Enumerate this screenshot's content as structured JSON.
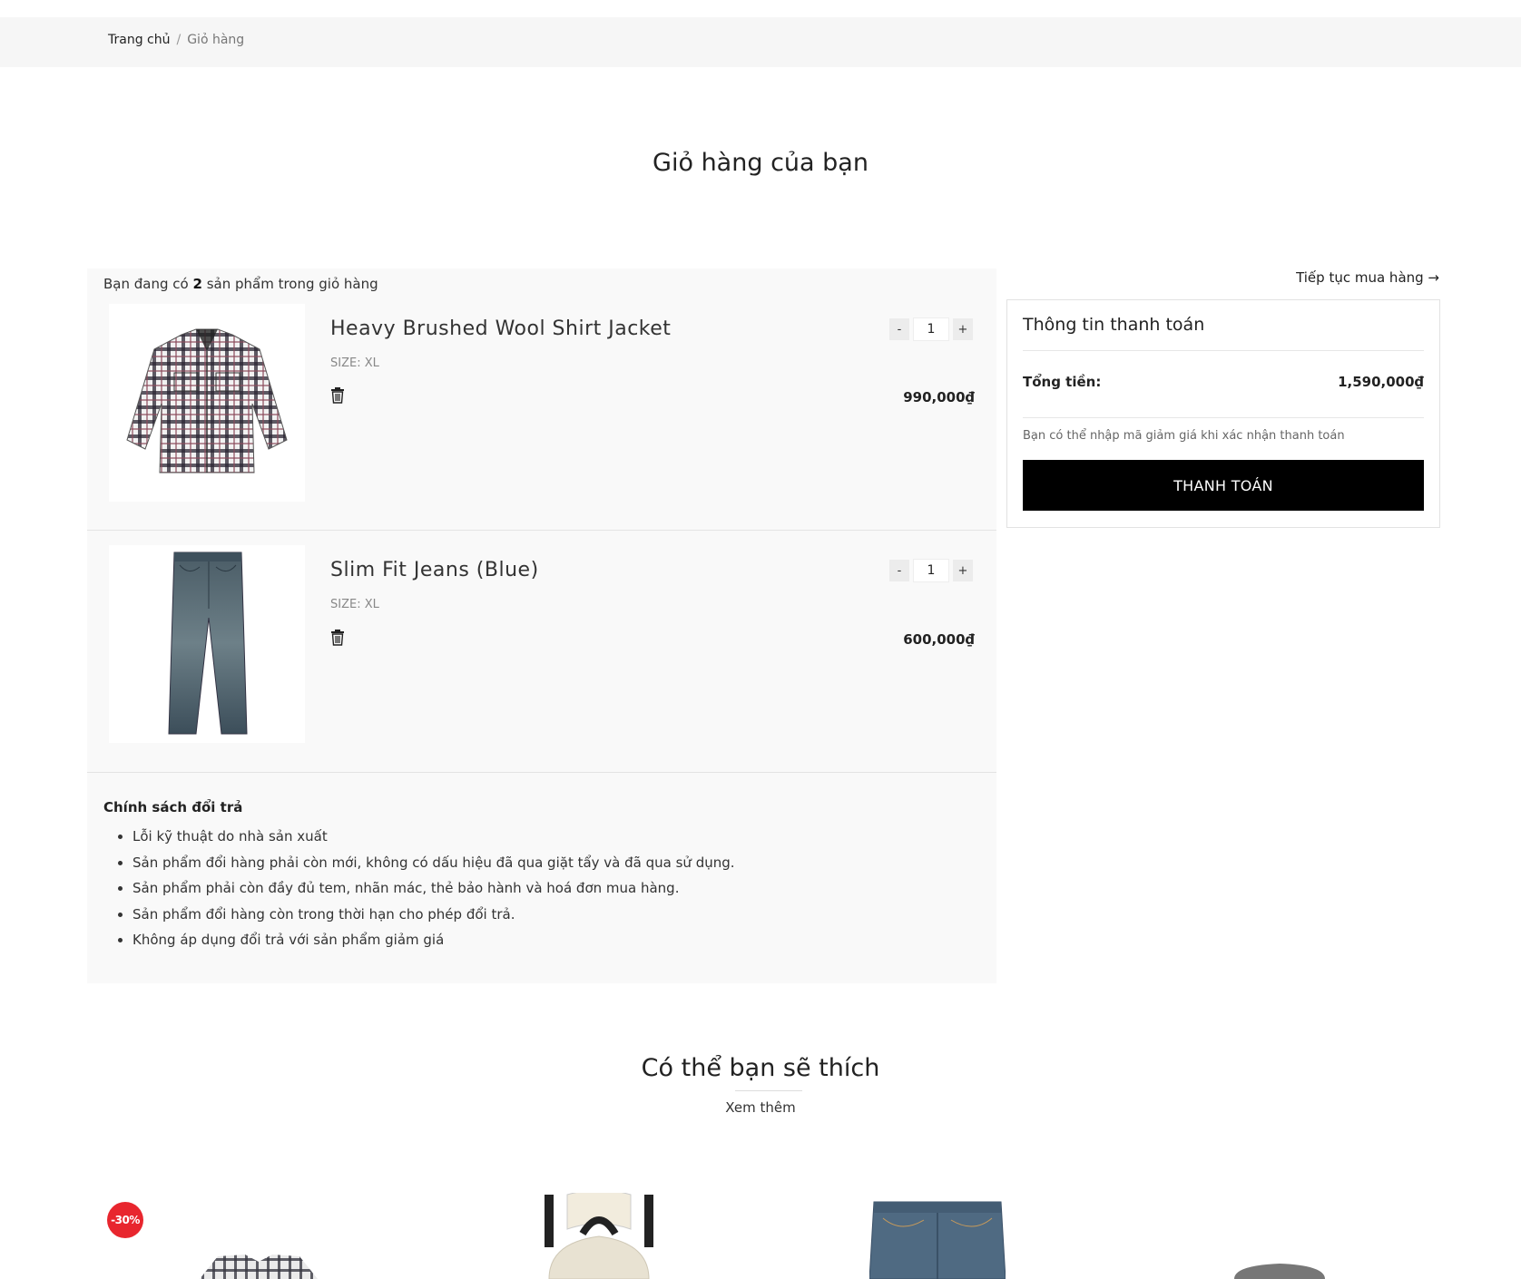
{
  "breadcrumb": {
    "home": "Trang chủ",
    "separator": "/",
    "current": "Giỏ hàng"
  },
  "page_title": "Giỏ hàng của bạn",
  "cart": {
    "count_prefix": "Bạn đang có",
    "count_value": "2",
    "count_suffix": "sản phẩm trong giỏ hàng",
    "items": [
      {
        "name": "Heavy Brushed Wool Shirt Jacket",
        "size": "SIZE: XL",
        "quantity": "1",
        "price": "990,000₫",
        "image": "plaid-shirt-jacket-image"
      },
      {
        "name": "Slim Fit Jeans (Blue)",
        "size": "SIZE: XL",
        "quantity": "1",
        "price": "600,000₫",
        "image": "blue-jeans-image"
      }
    ],
    "qty_minus": "-",
    "qty_plus": "+"
  },
  "policy": {
    "title": "Chính sách đổi trả",
    "items": [
      "Lỗi kỹ thuật do nhà sản xuất",
      "Sản phẩm đổi hàng phải còn mới, không có dấu hiệu đã qua giặt tẩy và đã qua sử dụng.",
      "Sản phẩm phải còn đầy đủ tem, nhãn mác, thẻ bảo hành và hoá đơn mua hàng.",
      "Sản phẩm đổi hàng còn trong thời hạn cho phép đổi trả.",
      "Không áp dụng đổi trả với sản phẩm giảm giá"
    ]
  },
  "continue_shopping": "Tiếp tục mua hàng →",
  "payment": {
    "title": "Thông tin thanh toán",
    "total_label": "Tổng tiền:",
    "total_value": "1,590,000₫",
    "note": "Bạn có thể nhập mã giảm giá khi xác nhận thanh toán",
    "button": "THANH TOÁN"
  },
  "recommendations": {
    "title": "Có thể bạn sẽ thích",
    "more": "Xem thêm",
    "badge": "-30%",
    "products": [
      "plaid-shirt-image",
      "backpack-image",
      "jeans-image",
      "gray-item-image"
    ]
  },
  "colors": {
    "accent_button": "#000000",
    "badge": "#e8262e",
    "panel_bg": "#f9f9f9",
    "breadcrumb_bg": "#f6f6f6"
  }
}
